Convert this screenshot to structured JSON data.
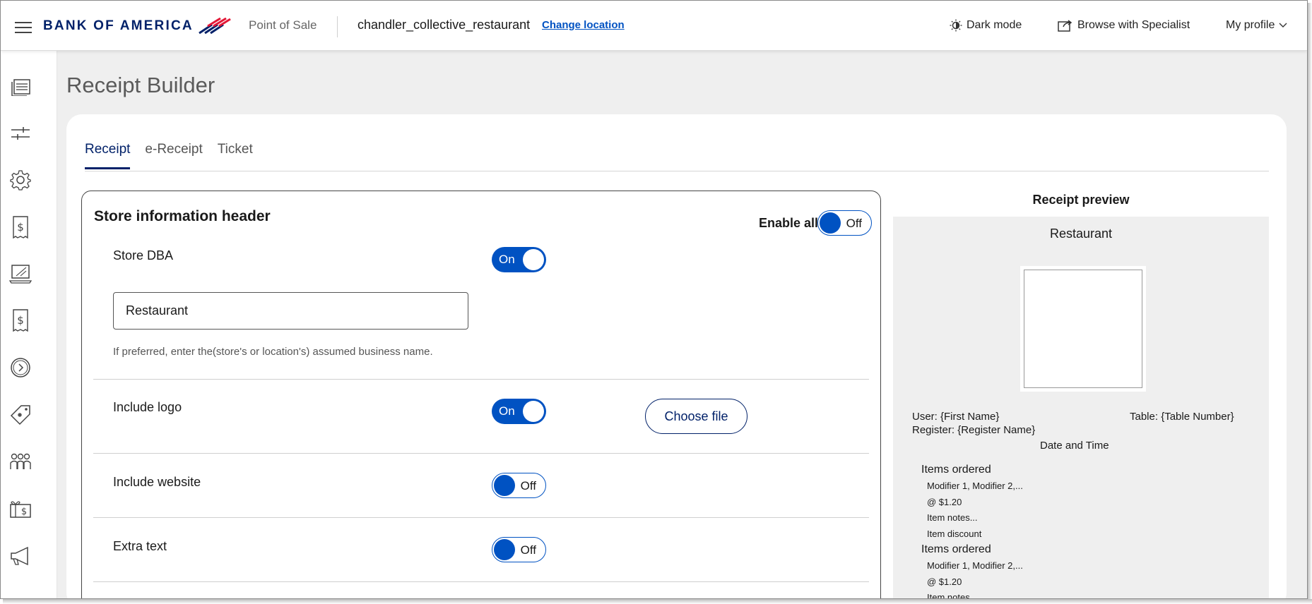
{
  "header": {
    "brand": "BANK OF AMERICA",
    "app_name": "Point of Sale",
    "location": "chandler_collective_restaurant",
    "change_location": "Change location",
    "dark_mode": "Dark mode",
    "browse_specialist": "Browse with Specialist",
    "my_profile": "My profile"
  },
  "sidebar": {
    "icons": [
      "layers-icon",
      "sliders-icon",
      "gear-icon",
      "receipt-dollar-icon",
      "tablet-icon",
      "receipt-dollar-icon",
      "clock-arrow-icon",
      "tag-icon",
      "people-icon",
      "gift-card-icon",
      "megaphone-icon"
    ]
  },
  "page": {
    "title": "Receipt Builder",
    "tabs": [
      {
        "label": "Receipt",
        "active": true
      },
      {
        "label": "e-Receipt",
        "active": false
      },
      {
        "label": "Ticket",
        "active": false
      }
    ]
  },
  "store_header": {
    "title": "Store information header",
    "enable_all_label": "Enable all",
    "enable_all_state": "Off",
    "rows": {
      "store_dba": {
        "label": "Store DBA",
        "state": "On",
        "value": "Restaurant",
        "helper": "If preferred, enter the(store's or location's) assumed business name."
      },
      "include_logo": {
        "label": "Include logo",
        "state": "On",
        "button": "Choose file"
      },
      "include_website": {
        "label": "Include website",
        "state": "Off"
      },
      "extra_text": {
        "label": "Extra text",
        "state": "Off"
      }
    }
  },
  "preview": {
    "title": "Receipt preview",
    "store_name": "Restaurant",
    "user": "User: {First Name}",
    "table": "Table: {Table Number}",
    "register": "Register: {Register Name}",
    "date_time": "Date and Time",
    "items": [
      {
        "heading": "Items ordered",
        "modifiers": "Modifier 1, Modifier 2,...",
        "price": "@ $1.20",
        "notes": "Item notes...",
        "discount": "Item discount"
      },
      {
        "heading": "Items ordered",
        "modifiers": "Modifier 1, Modifier 2,...",
        "price": "@ $1.20",
        "notes": "Item notes..."
      }
    ]
  },
  "colors": {
    "brand_navy": "#012169",
    "accent_blue": "#0052c2",
    "brand_red": "#e31837"
  }
}
